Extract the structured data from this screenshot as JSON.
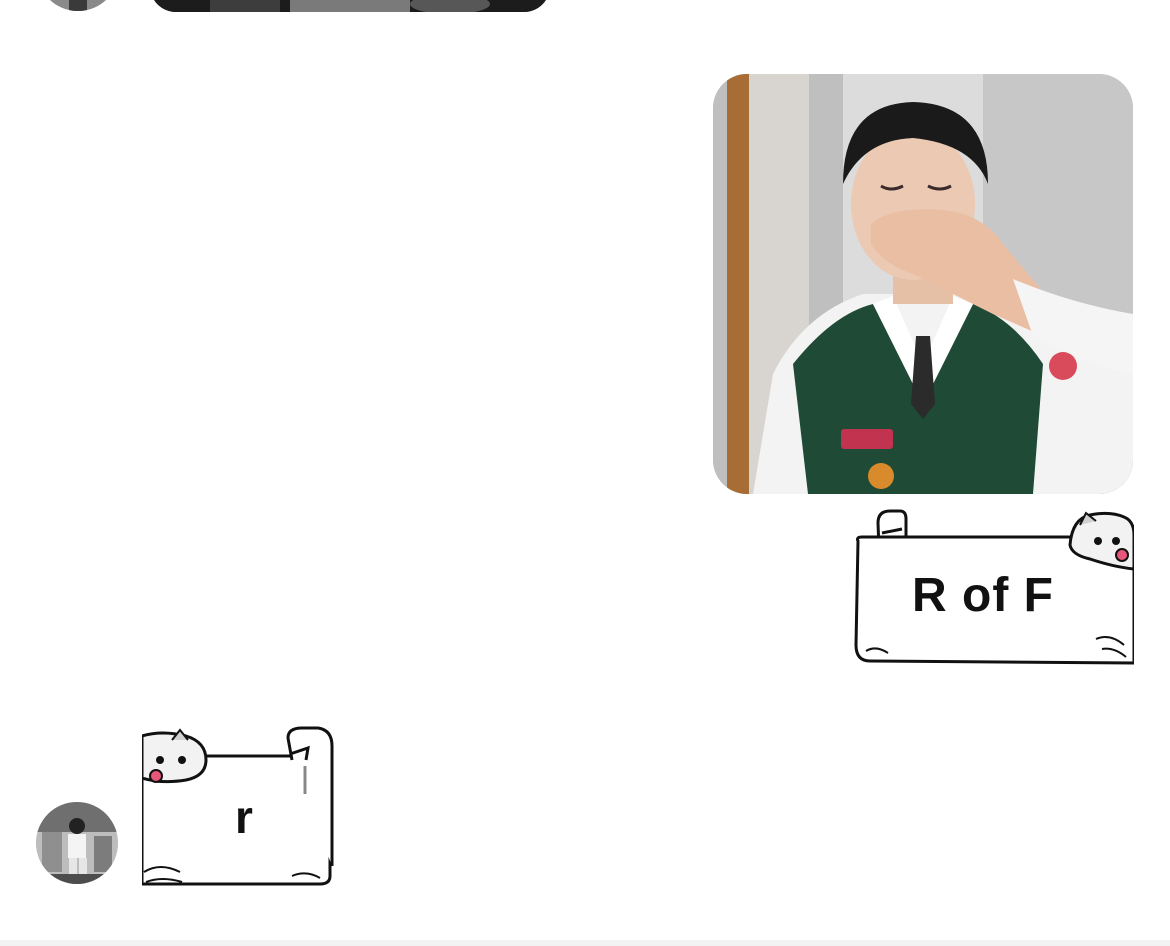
{
  "conversation": {
    "messages": [
      {
        "type": "media",
        "sender": "other"
      },
      {
        "type": "photo",
        "sender": "me"
      },
      {
        "type": "sticker",
        "sender": "me",
        "text": "R of F"
      },
      {
        "type": "sticker",
        "sender": "other",
        "text": "r"
      }
    ]
  },
  "colors": {
    "background": "#ffffff",
    "sticker_outline": "#111111",
    "sticker_fill": "#ffffff",
    "tongue": "#e8577a",
    "vest": "#1f4a36"
  },
  "icons": {
    "avatar": "user-avatar-icon",
    "sticker_character": "cat-sticker-icon"
  }
}
